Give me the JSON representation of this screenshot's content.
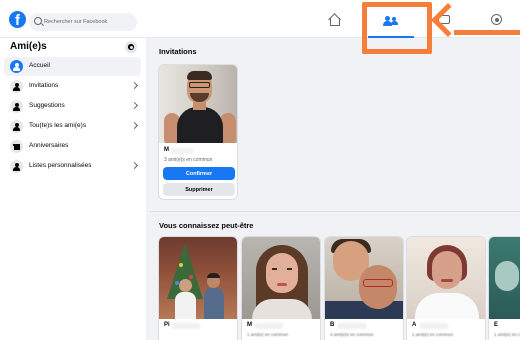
{
  "header": {
    "search_placeholder": "Rechercher sur Facebook",
    "logo_letter": "f"
  },
  "sidebar": {
    "title": "Ami(e)s",
    "items": [
      {
        "label": "Accueil"
      },
      {
        "label": "Invitations"
      },
      {
        "label": "Suggestions"
      },
      {
        "label": "Tou(te)s les ami(e)s"
      },
      {
        "label": "Anniversaires"
      },
      {
        "label": "Listes personnalisées"
      }
    ]
  },
  "invitations": {
    "title": "Invitations",
    "card": {
      "name": "M",
      "mutual": "3 ami(e)s en commun",
      "confirm_label": "Confirmer",
      "delete_label": "Supprimer"
    }
  },
  "suggestions": {
    "title": "Vous connaissez peut-être",
    "cards": [
      {
        "name": "Pi",
        "mutual": ""
      },
      {
        "name": "M",
        "mutual": "1 ami(e) en commun"
      },
      {
        "name": "B",
        "mutual": "4 ami(e)s en commun"
      },
      {
        "name": "A",
        "mutual": "1 ami(e) en commun"
      },
      {
        "name": "E",
        "mutual": "1 ami(e) en commun"
      }
    ]
  },
  "colors": {
    "brand": "#1877f2",
    "annotation": "#f47e3a"
  }
}
